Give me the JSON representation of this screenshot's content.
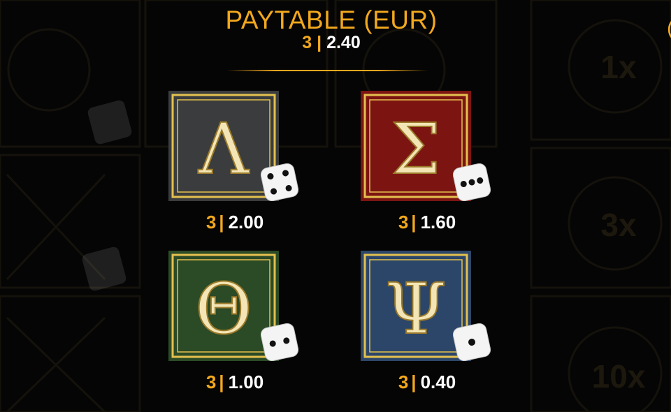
{
  "title": "PAYTABLE (EUR)",
  "scrolled_row": {
    "count": "3",
    "sep": "|",
    "value": "2.40"
  },
  "background": {
    "reel_multipliers": [
      "1x",
      "3x",
      "10x"
    ]
  },
  "symbols": [
    {
      "glyph": "Λ",
      "icon": "lambda-symbol-icon",
      "dice_icon": "dice-four-icon",
      "count": "3",
      "sep": "|",
      "payout": "2.00",
      "color": "#3a3c3d"
    },
    {
      "glyph": "Σ",
      "icon": "sigma-symbol-icon",
      "dice_icon": "dice-three-icon",
      "count": "3",
      "sep": "|",
      "payout": "1.60",
      "color": "#7c1512"
    },
    {
      "glyph": "Θ",
      "icon": "theta-symbol-icon",
      "dice_icon": "dice-two-icon",
      "count": "3",
      "sep": "|",
      "payout": "1.00",
      "color": "#2b4a26"
    },
    {
      "glyph": "Ψ",
      "icon": "psi-symbol-icon",
      "dice_icon": "dice-one-icon",
      "count": "3",
      "sep": "|",
      "payout": "0.40",
      "color": "#2c4669"
    }
  ],
  "colors": {
    "accent": "#f2a81d",
    "frame": "#e4c04f",
    "text": "#ffffff",
    "background": "#050505"
  }
}
